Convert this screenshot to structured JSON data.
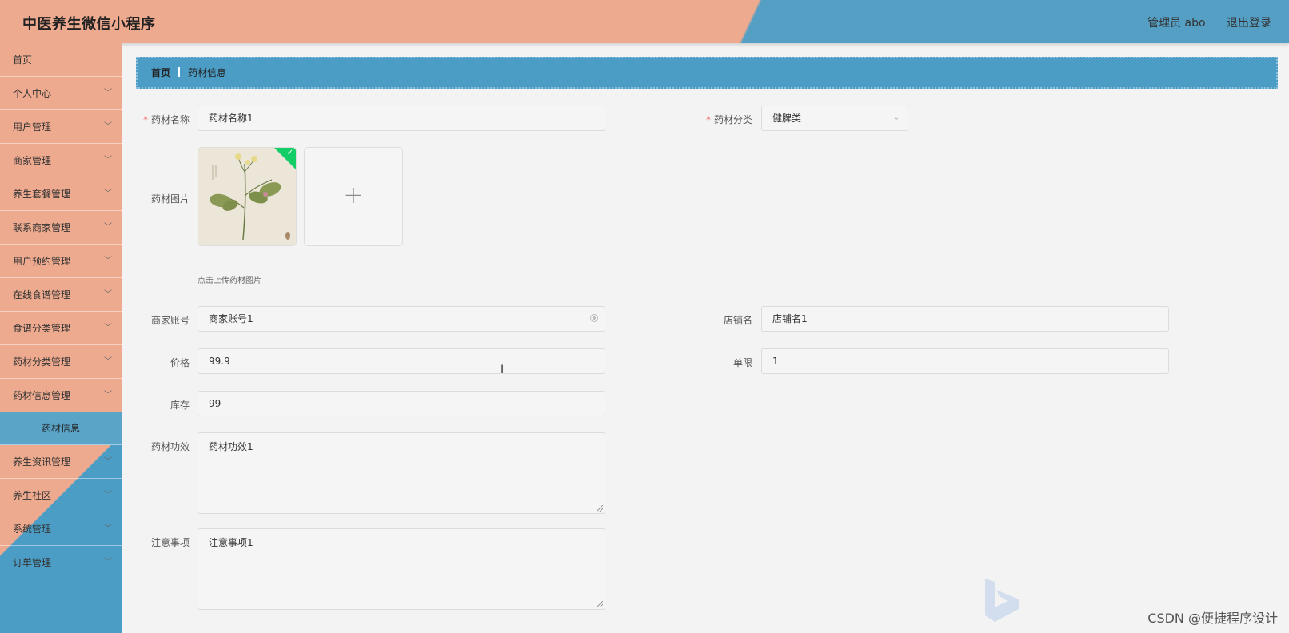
{
  "header": {
    "app_title": "中医养生微信小程序",
    "user_label": "管理员 abo",
    "logout_label": "退出登录"
  },
  "sidebar": {
    "items": [
      {
        "label": "首页",
        "has_arrow": false
      },
      {
        "label": "个人中心",
        "has_arrow": true
      },
      {
        "label": "用户管理",
        "has_arrow": true
      },
      {
        "label": "商家管理",
        "has_arrow": true
      },
      {
        "label": "养生套餐管理",
        "has_arrow": true
      },
      {
        "label": "联系商家管理",
        "has_arrow": true
      },
      {
        "label": "用户预约管理",
        "has_arrow": true
      },
      {
        "label": "在线食谱管理",
        "has_arrow": true
      },
      {
        "label": "食谱分类管理",
        "has_arrow": true
      },
      {
        "label": "药材分类管理",
        "has_arrow": true
      },
      {
        "label": "药材信息管理",
        "has_arrow": true
      }
    ],
    "active_sub": "药材信息",
    "items_after": [
      {
        "label": "养生资讯管理",
        "has_arrow": true
      },
      {
        "label": "养生社区",
        "has_arrow": true
      },
      {
        "label": "系统管理",
        "has_arrow": true
      },
      {
        "label": "订单管理",
        "has_arrow": true
      }
    ]
  },
  "breadcrumb": {
    "home": "首页",
    "current": "药材信息"
  },
  "form": {
    "name_label": "药材名称",
    "name_value": "药材名称1",
    "category_label": "药材分类",
    "category_value": "健脾类",
    "image_label": "药材图片",
    "upload_tip": "点击上传药材图片",
    "merchant_label": "商家账号",
    "merchant_value": "商家账号1",
    "shop_label": "店铺名",
    "shop_value": "店铺名1",
    "price_label": "价格",
    "price_value": "99.9",
    "limit_label": "单限",
    "limit_value": "1",
    "stock_label": "库存",
    "stock_value": "99",
    "effect_label": "药材功效",
    "effect_value": "药材功效1",
    "notes_label": "注意事项",
    "notes_value": "注意事项1"
  },
  "watermark": "CSDN @便捷程序设计",
  "colors": {
    "peach": "#eeaa8f",
    "blue": "#4b9dc5",
    "required": "#f56c6c",
    "success": "#13ce66"
  }
}
